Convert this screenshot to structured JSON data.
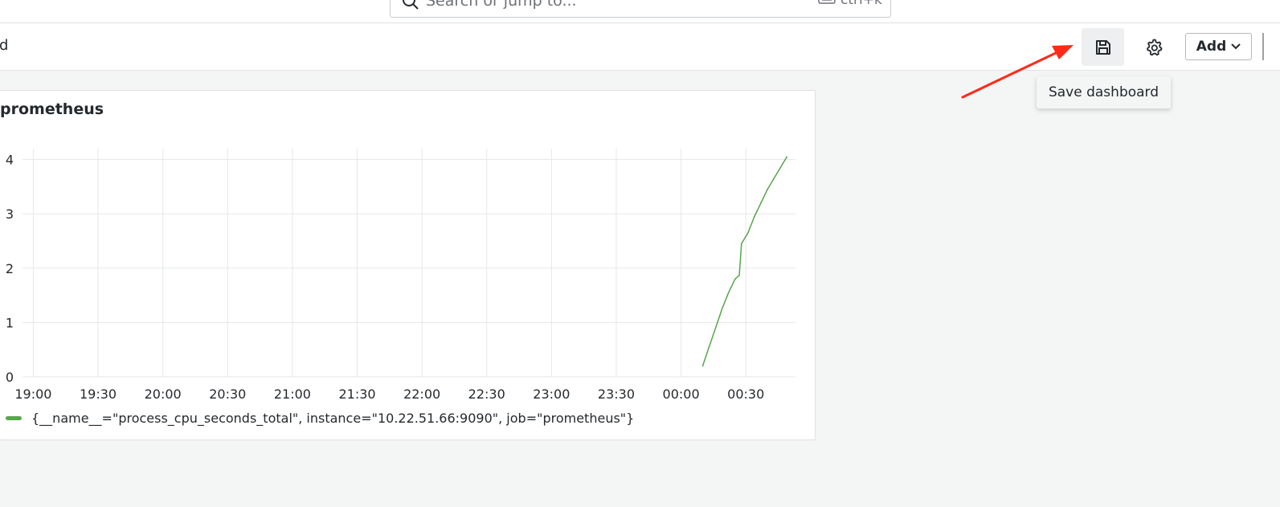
{
  "search": {
    "placeholder": "Search or jump to...",
    "shortcut": "ctrl+k"
  },
  "breadcrumb": {
    "text": "d"
  },
  "toolbar": {
    "add_label": "Add",
    "save_tooltip": "Save dashboard"
  },
  "panel": {
    "title": "prometheus"
  },
  "colors": {
    "series": "#56a64b",
    "annotation_arrow": "#ff2a1a"
  },
  "chart_data": {
    "type": "line",
    "title": "prometheus",
    "xlabel": "",
    "ylabel": "",
    "x_ticks": [
      "19:00",
      "19:30",
      "20:00",
      "20:30",
      "21:00",
      "21:30",
      "22:00",
      "22:30",
      "23:00",
      "23:30",
      "00:00",
      "00:30"
    ],
    "y_ticks": [
      0,
      1,
      2,
      3,
      4
    ],
    "ylim": [
      0,
      4.2
    ],
    "xlim": [
      "18:55",
      "00:53"
    ],
    "grid": true,
    "legend_placement": "bottom-left",
    "series": [
      {
        "name": "{__name__=\"process_cpu_seconds_total\", instance=\"10.22.51.66:9090\", job=\"prometheus\"}",
        "color": "#56a64b",
        "points": [
          [
            "00:10",
            0.2
          ],
          [
            "00:13",
            0.55
          ],
          [
            "00:16",
            0.9
          ],
          [
            "00:19",
            1.25
          ],
          [
            "00:22",
            1.55
          ],
          [
            "00:25",
            1.8
          ],
          [
            "00:27",
            1.87
          ],
          [
            "00:28",
            2.45
          ],
          [
            "00:31",
            2.65
          ],
          [
            "00:34",
            2.95
          ],
          [
            "00:37",
            3.2
          ],
          [
            "00:40",
            3.45
          ],
          [
            "00:43",
            3.65
          ],
          [
            "00:46",
            3.85
          ],
          [
            "00:49",
            4.05
          ]
        ]
      }
    ]
  }
}
